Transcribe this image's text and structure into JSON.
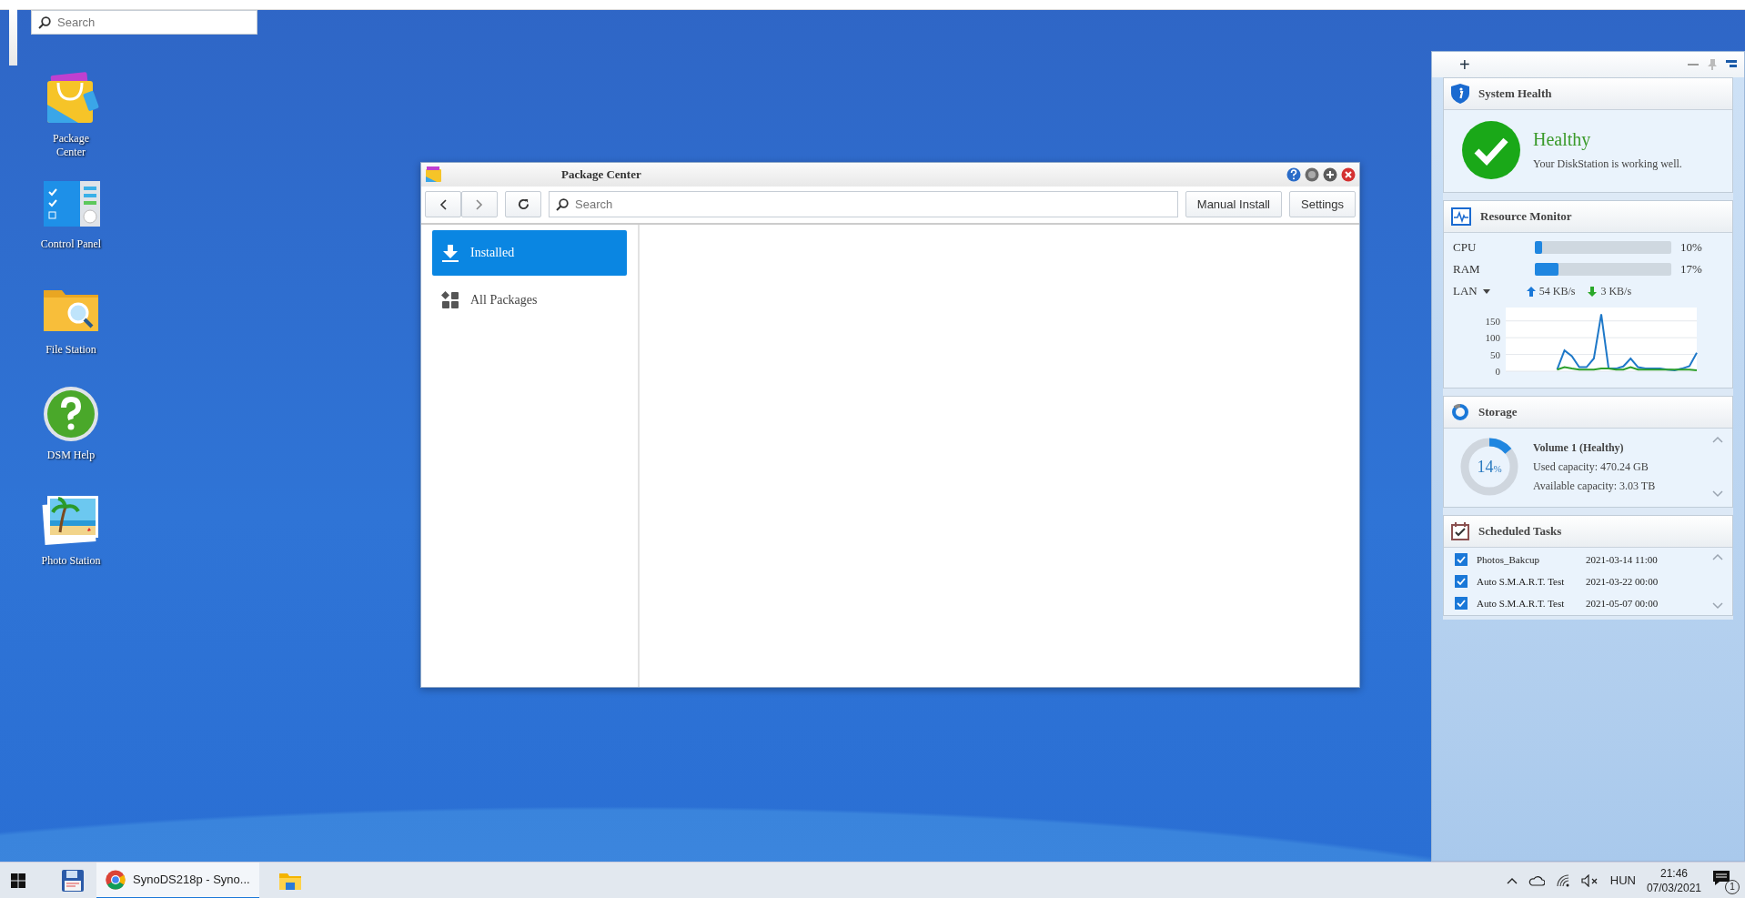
{
  "desktop": {
    "search": {
      "placeholder": "Search"
    },
    "icons": [
      {
        "label": "Package Center",
        "kind": "package"
      },
      {
        "label": "Control Panel",
        "kind": "control"
      },
      {
        "label": "File Station",
        "kind": "files"
      },
      {
        "label": "DSM Help",
        "kind": "help"
      },
      {
        "label": "Photo Station",
        "kind": "photo"
      }
    ]
  },
  "window": {
    "title": "Package Center",
    "search": {
      "placeholder": "Search"
    },
    "buttons": [
      "Manual Install",
      "Settings"
    ],
    "sidebar": {
      "items": [
        {
          "label": "Installed",
          "kind": "installed",
          "selected": true
        },
        {
          "label": "All Packages",
          "kind": "all",
          "selected": false
        }
      ]
    }
  },
  "widget_panel": {
    "add_button": "+",
    "system_health": {
      "title": "System Health",
      "status": "Healthy",
      "message": "Your DiskStation is working well."
    },
    "resource_monitor": {
      "title": "Resource Monitor",
      "meters": [
        {
          "label": "CPU",
          "level": 0.05,
          "reading": "10%"
        },
        {
          "label": "RAM",
          "level": 0.17,
          "reading": "17%"
        }
      ],
      "network": {
        "label": "LAN",
        "upload": "54 KB/s",
        "download": "3 KB/s"
      },
      "chart_data": {
        "type": "line",
        "grid": true,
        "ylim": [
          0,
          190
        ],
        "yticks": [
          0,
          50,
          100,
          150
        ],
        "series": [
          {
            "color": "#1e78c8",
            "values": [
              null,
              null,
              null,
              null,
              null,
              null,
              null,
              5,
              62,
              45,
              12,
              12,
              38,
              170,
              8,
              8,
              14,
              38,
              12,
              8,
              8,
              8,
              5,
              3,
              8,
              15,
              55
            ]
          },
          {
            "color": "#2ca02c",
            "values": [
              null,
              null,
              null,
              null,
              null,
              null,
              null,
              5,
              12,
              8,
              5,
              5,
              5,
              8,
              8,
              5,
              5,
              12,
              5,
              5,
              5,
              5,
              5,
              5,
              5,
              5,
              3
            ]
          }
        ]
      }
    },
    "storage": {
      "title": "Storage",
      "percent": "14",
      "unit": "%",
      "level": 0.14,
      "volume": "Volume 1 (Healthy)",
      "used": "Used capacity: 470.24 GB",
      "available": "Available capacity: 3.03 TB"
    },
    "scheduled_tasks": {
      "title": "Scheduled Tasks",
      "tasks": [
        {
          "name": "Photos_Bakcup",
          "time": "2021-03-14 11:00",
          "checked": true
        },
        {
          "name": "Auto S.M.A.R.T. Test",
          "time": "2021-03-22 00:00",
          "checked": true
        },
        {
          "name": "Auto S.M.A.R.T. Test",
          "time": "2021-05-07 00:00",
          "checked": true
        }
      ]
    }
  },
  "taskbar": {
    "tasks": [
      {
        "label": "SynoDS218p - Syno...",
        "selected": true
      }
    ],
    "language": "HUN",
    "time": "21:46",
    "date": "07/03/2021",
    "notifications": "1"
  }
}
